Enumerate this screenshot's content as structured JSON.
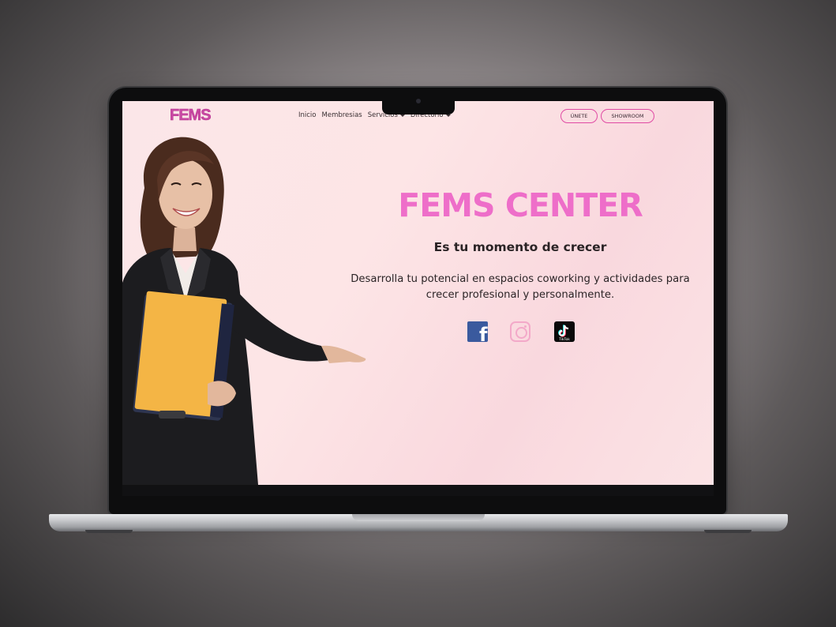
{
  "site": {
    "logo": "FEMS",
    "menu": [
      {
        "label": "Inicio",
        "has_dropdown": false
      },
      {
        "label": "Membresias",
        "has_dropdown": false
      },
      {
        "label": "Servicios",
        "has_dropdown": true
      },
      {
        "label": "Directorio",
        "has_dropdown": true
      }
    ],
    "buttons": {
      "join": "ÚNETE",
      "showroom": "SHOWROOM"
    }
  },
  "hero": {
    "title": "FEMS CENTER",
    "subtitle": "Es tu momento de crecer",
    "description_line1": "Desarrolla tu potencial en espacios coworking y actividades para",
    "description_line2": "crecer profesional y personalmente.",
    "social": [
      {
        "name": "facebook-icon",
        "label": "f"
      },
      {
        "name": "instagram-icon"
      },
      {
        "name": "tiktok-icon",
        "label": "TikTok"
      }
    ]
  },
  "colors": {
    "accent": "#ee6ec9",
    "logo": "#c94aa4",
    "button_border": "#e04aa4",
    "facebook": "#3a5a9e",
    "instagram": "#f3a9c9",
    "tiktok": "#0a0a0a"
  }
}
